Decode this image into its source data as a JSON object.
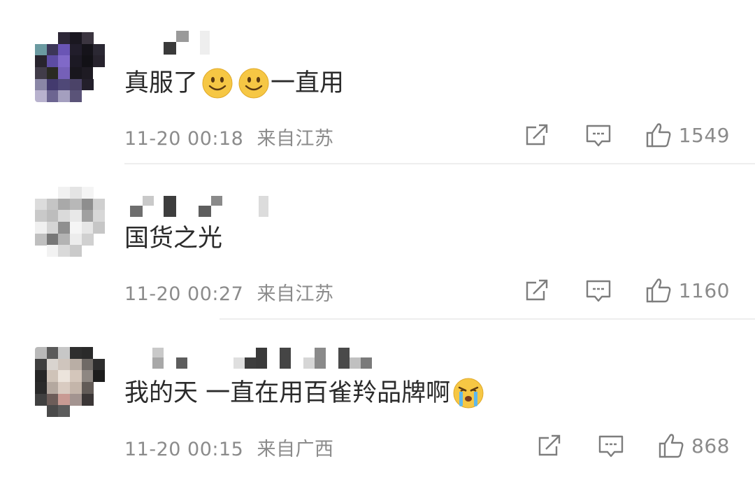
{
  "comments": [
    {
      "text": "真服了",
      "text_after": "一直用",
      "emoji": [
        "smile-emoji",
        "smile-emoji"
      ],
      "time": "11-20 00:18",
      "location": "来自江苏",
      "likes": "1549"
    },
    {
      "text": "国货之光",
      "time": "11-20 00:27",
      "location": "来自江苏",
      "likes": "1160"
    },
    {
      "text": "我的天 一直在用百雀羚品牌啊",
      "emoji": [
        "crying-emoji"
      ],
      "time": "11-20 00:15",
      "location": "来自广西",
      "likes": "868"
    }
  ],
  "colors": {
    "meta_text": "#8b8b8b",
    "divider": "#eeeeee",
    "emoji_yellow": "#f6c744"
  }
}
